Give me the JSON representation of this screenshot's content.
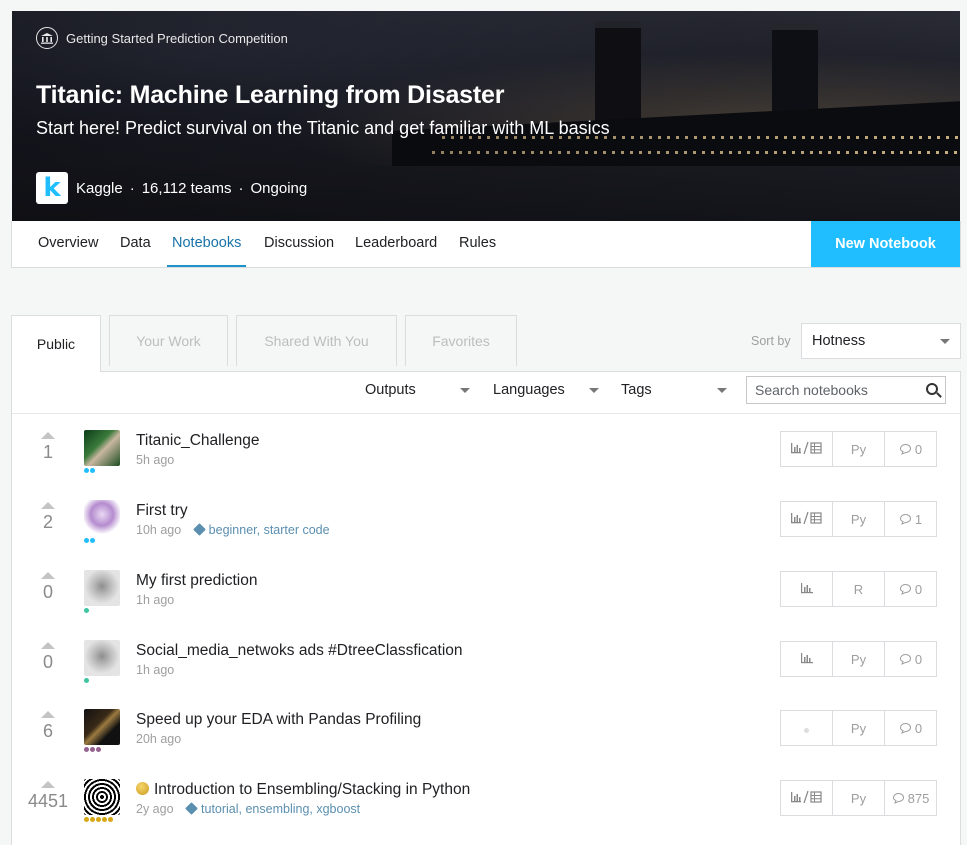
{
  "hero": {
    "competition_type": "Getting Started Prediction Competition",
    "title": "Titanic: Machine Learning from Disaster",
    "subtitle": "Start here! Predict survival on the Titanic and get familiar with ML basics",
    "host": "Kaggle",
    "teams": "16,112 teams",
    "status": "Ongoing",
    "logo_letter": "k"
  },
  "nav": {
    "tabs": [
      "Overview",
      "Data",
      "Notebooks",
      "Discussion",
      "Leaderboard",
      "Rules"
    ],
    "active": "Notebooks",
    "new_notebook": "New Notebook"
  },
  "content_tabs": [
    "Public",
    "Your Work",
    "Shared With You",
    "Favorites"
  ],
  "sort": {
    "label": "Sort by",
    "value": "Hotness"
  },
  "filters": {
    "outputs": "Outputs",
    "languages": "Languages",
    "tags": "Tags",
    "search_placeholder": "Search notebooks"
  },
  "notebooks": [
    {
      "votes": "1",
      "title": "Titanic_Challenge",
      "time": "5h ago",
      "tags": "",
      "output": "chart-table-icon",
      "lang": "Py",
      "comments": "0",
      "tier": "#20beff"
    },
    {
      "votes": "2",
      "title": "First try",
      "time": "10h ago",
      "tags": "beginner, starter code",
      "output": "chart-table-icon",
      "lang": "Py",
      "comments": "1",
      "tier": "#20beff"
    },
    {
      "votes": "0",
      "title": "My first prediction",
      "time": "1h ago",
      "tags": "",
      "output": "chart-icon",
      "lang": "R",
      "comments": "0",
      "tier": "#3cc5a0"
    },
    {
      "votes": "0",
      "title": "Social_media_netwoks ads #DtreeClassfication",
      "time": "1h ago",
      "tags": "",
      "output": "chart-icon",
      "lang": "Py",
      "comments": "0",
      "tier": "#3cc5a0"
    },
    {
      "votes": "6",
      "title": "Speed up your EDA with Pandas Profiling",
      "time": "20h ago",
      "tags": "",
      "output": "none-dot-icon",
      "lang": "Py",
      "comments": "0",
      "tier": "#95628f"
    },
    {
      "votes": "4451",
      "title": "Introduction to Ensembling/Stacking in Python",
      "time": "2y ago",
      "tags": "tutorial, ensembling, xgboost",
      "output": "chart-table-icon",
      "lang": "Py",
      "comments": "875",
      "tier": "#d6a614",
      "medal": "gold"
    }
  ],
  "colors": {
    "accent": "#20beff",
    "nav_active": "#1a73a8",
    "tag": "#5b8fb0"
  }
}
